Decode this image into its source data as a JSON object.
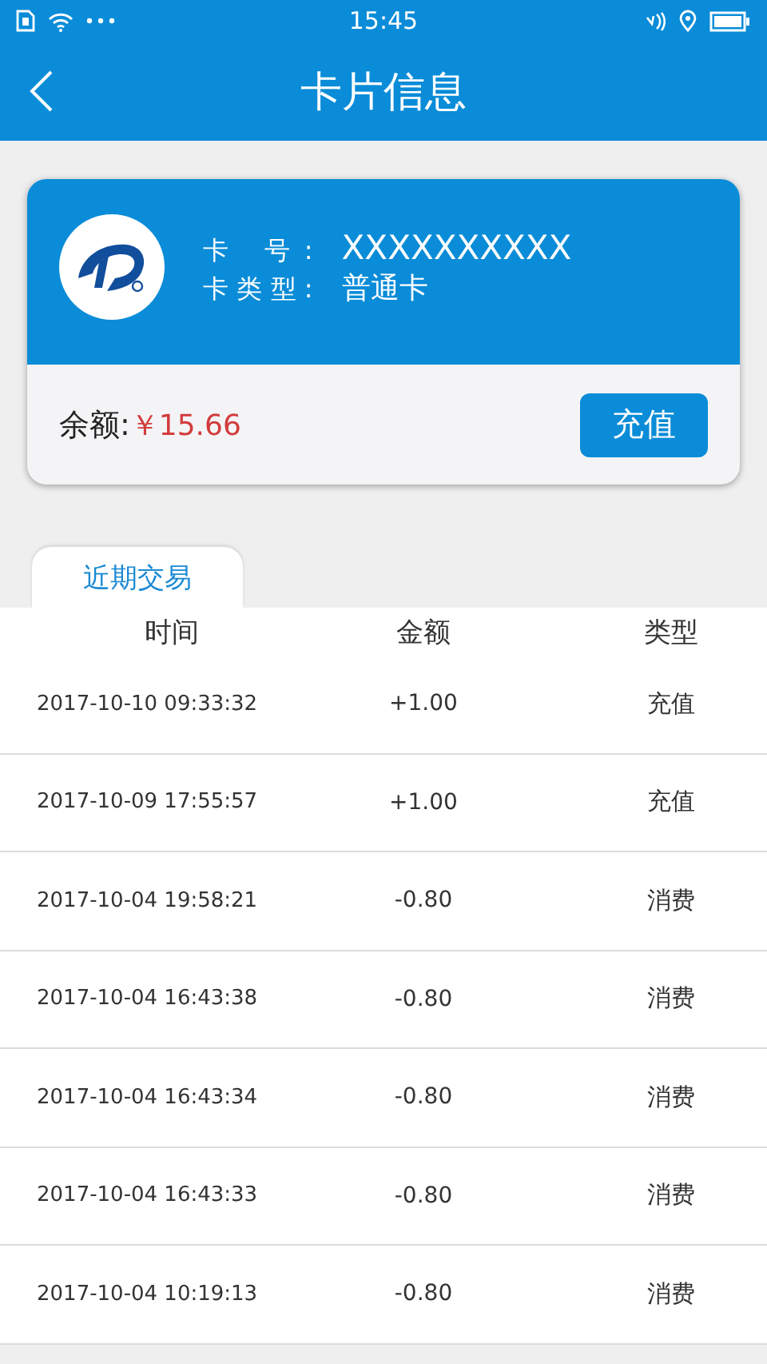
{
  "status_bar": {
    "time": "15:45"
  },
  "header": {
    "title": "卡片信息"
  },
  "card": {
    "number_label": "卡 号:",
    "number": "XXXXXXXXXX",
    "type_label": "卡类型:",
    "type": "普通卡",
    "balance_label": "余额:",
    "balance": "￥15.66",
    "recharge_button": "充值"
  },
  "tabs": [
    {
      "label": "近期交易",
      "selected": true
    }
  ],
  "table": {
    "columns": [
      "时间",
      "金额",
      "类型"
    ],
    "rows": [
      {
        "time": "2017-10-10 09:33:32",
        "amount": "+1.00",
        "type": "充值"
      },
      {
        "time": "2017-10-09 17:55:57",
        "amount": "+1.00",
        "type": "充值"
      },
      {
        "time": "2017-10-04 19:58:21",
        "amount": "-0.80",
        "type": "消费"
      },
      {
        "time": "2017-10-04 16:43:38",
        "amount": "-0.80",
        "type": "消费"
      },
      {
        "time": "2017-10-04 16:43:34",
        "amount": "-0.80",
        "type": "消费"
      },
      {
        "time": "2017-10-04 16:43:33",
        "amount": "-0.80",
        "type": "消费"
      },
      {
        "time": "2017-10-04 10:19:13",
        "amount": "-0.80",
        "type": "消费"
      }
    ]
  }
}
